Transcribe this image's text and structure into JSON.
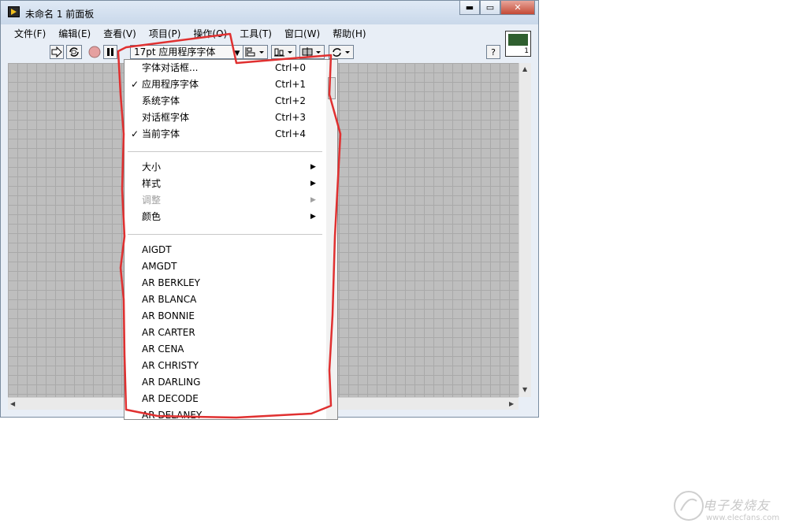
{
  "window": {
    "title": "未命名 1 前面板",
    "controls": {
      "minimize": "▬",
      "maximize": "▭",
      "close": "✕"
    }
  },
  "menubar": [
    "文件(F)",
    "编辑(E)",
    "查看(V)",
    "项目(P)",
    "操作(O)",
    "工具(T)",
    "窗口(W)",
    "帮助(H)"
  ],
  "toolbar": {
    "font_select_value": "17pt 应用程序字体",
    "help_label": "?",
    "icons": [
      "run-arrow-icon",
      "run-continuously-icon",
      "abort-icon",
      "pause-icon",
      "align-icon",
      "distribute-icon",
      "resize-icon",
      "reorder-icon",
      "help-icon"
    ]
  },
  "vi_icon": {
    "number": "1"
  },
  "dropdown": {
    "group1": [
      {
        "label": "字体对话框...",
        "shortcut": "Ctrl+0",
        "checked": false
      },
      {
        "label": "应用程序字体",
        "shortcut": "Ctrl+1",
        "checked": true
      },
      {
        "label": "系统字体",
        "shortcut": "Ctrl+2",
        "checked": false
      },
      {
        "label": "对话框字体",
        "shortcut": "Ctrl+3",
        "checked": false
      },
      {
        "label": "当前字体",
        "shortcut": "Ctrl+4",
        "checked": true
      }
    ],
    "group2": [
      {
        "label": "大小",
        "disabled": false
      },
      {
        "label": "样式",
        "disabled": false
      },
      {
        "label": "调整",
        "disabled": true
      },
      {
        "label": "颜色",
        "disabled": false
      }
    ],
    "fonts": [
      "AIGDT",
      "AMGDT",
      "AR BERKLEY",
      "AR BLANCA",
      "AR BONNIE",
      "AR CARTER",
      "AR CENA",
      "AR CHRISTY",
      "AR DARLING",
      "AR DECODE",
      "AR DELANEY"
    ],
    "check_glyph": "✓",
    "submenu_glyph": "▶"
  },
  "watermark": {
    "text": "电子发烧友",
    "url": "www.elecfans.com"
  },
  "colors": {
    "annotation": "#e03030",
    "grid_bg": "#bebebe",
    "grid_line": "#a9a9a9"
  }
}
